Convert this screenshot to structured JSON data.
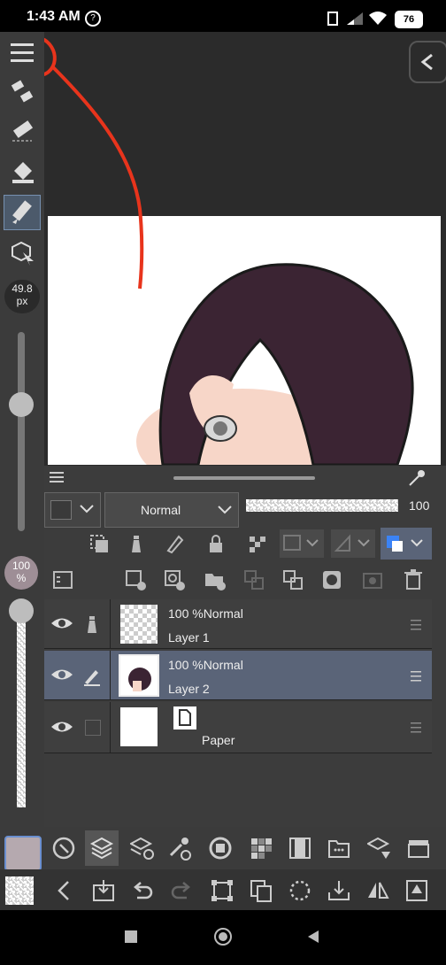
{
  "status": {
    "time": "1:43 AM",
    "battery": "76"
  },
  "toolbar": {
    "brush_size": "49.8",
    "brush_unit": "px",
    "opacity": "100",
    "opacity_unit": "%"
  },
  "layer_panel": {
    "blend_mode": "Normal",
    "opacity_value": "100",
    "layers": [
      {
        "name": "Layer 1",
        "opacity_blend": "100 %Normal",
        "visible": true,
        "selected": false
      },
      {
        "name": "Layer 2",
        "opacity_blend": "100 %Normal",
        "visible": true,
        "selected": true
      },
      {
        "name": "Paper",
        "visible": true,
        "selected": false
      }
    ]
  },
  "colors": {
    "accent": "#5a6478",
    "annotation": "#e8341c",
    "hair": "#3b2433",
    "main_color": "#b5a9af"
  }
}
